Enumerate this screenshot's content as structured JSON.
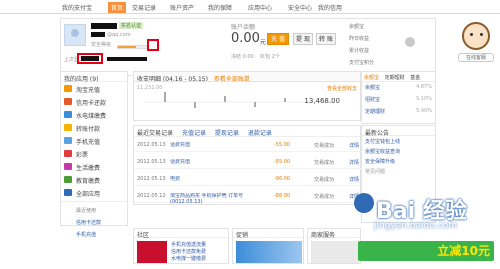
{
  "topnav": {
    "items": [
      "我的支付宝",
      "首页",
      "交易记录",
      "账户资产",
      "我的保障",
      "应用中心",
      "安全中心",
      "我的信用",
      "联系客服"
    ],
    "active_index": 1
  },
  "profile": {
    "email_suffix": "@qq.com",
    "badge": "实名认证",
    "edit_link": "修改",
    "level_label": "安全等级",
    "last_login": "上次登录",
    "progress": 0.6
  },
  "balance": {
    "label": "账户余额",
    "amount": "0.00",
    "unit": "元",
    "recharge": "充 值",
    "withdraw": "提 现",
    "transfer": "转 账",
    "frozen_label": "冻结",
    "frozen_value": "0.00",
    "coupon_label": "红包",
    "coupon_value": "2个"
  },
  "right_block": {
    "lines": [
      "余额宝",
      "昨日收益",
      "累计收益",
      "支付宝积分"
    ]
  },
  "mascot": {
    "label": "在线客服"
  },
  "sidebar": {
    "head": "我的应用 (9)",
    "items": [
      {
        "label": "淘宝充值",
        "color": "#f39800"
      },
      {
        "label": "信用卡还款",
        "color": "#e35b2c"
      },
      {
        "label": "水电煤缴费",
        "color": "#3c8dd9"
      },
      {
        "label": "转账付款",
        "color": "#f5b400"
      },
      {
        "label": "手机充值",
        "color": "#5aa3e0"
      },
      {
        "label": "彩票",
        "color": "#e03c3c"
      },
      {
        "label": "生活缴费",
        "color": "#c33aa8"
      },
      {
        "label": "教育缴费",
        "color": "#4c9f38"
      },
      {
        "label": "全部应用",
        "color": "#2f6ab5"
      }
    ],
    "recent_head": "最近使用",
    "recent_items": [
      "信用卡还款",
      "手机充值"
    ]
  },
  "main": {
    "head": "收支明细 (04.16 - 05.15)",
    "head_link": "查看全部账单",
    "y_top": "11,231.00",
    "amount": "13,468.00",
    "link": "查看全部收支"
  },
  "right_panel": {
    "tabs": [
      "余额宝",
      "定期理财",
      "基金"
    ],
    "products": [
      {
        "name": "余额宝",
        "rate": "4.87%"
      },
      {
        "name": "招财宝",
        "rate": "5.10%"
      },
      {
        "name": "定期理财",
        "rate": "5.40%"
      }
    ]
  },
  "records": {
    "tabs": [
      "最近交易记录",
      "充值记录",
      "提现记录",
      "退款记录"
    ],
    "rows": [
      {
        "date": "2012.05.13",
        "title": "话费充值",
        "amount": "-55.00",
        "status": "交易成功",
        "op": "详情"
      },
      {
        "date": "2012.05.13",
        "title": "话费充值",
        "amount": "-55.00",
        "status": "交易成功",
        "op": "详情"
      },
      {
        "date": "2012.05.13",
        "title": "电费",
        "amount": "-96.00",
        "status": "交易成功",
        "op": "详情"
      },
      {
        "date": "2012.05.12",
        "title": "淘宝商品购买 手机保护壳 订单号 (0012.05.13)",
        "amount": "-88.00",
        "status": "交易成功",
        "op": "详情"
      }
    ]
  },
  "aside": {
    "head": "最新公告",
    "lines": [
      "支付宝钱包上线",
      "余额宝收益查询",
      "安全保障升级",
      "常见问题"
    ]
  },
  "bottom": {
    "community_head": "社区",
    "community_lines": [
      "手机充值送流量",
      "信用卡还款免费",
      "水电煤一键缴费"
    ],
    "ad_head": "促销",
    "service_head": "商家服务"
  },
  "watermark": {
    "logo": "Bai 经验",
    "url": "jingyan.baidu.com",
    "banner": "立减10元"
  }
}
